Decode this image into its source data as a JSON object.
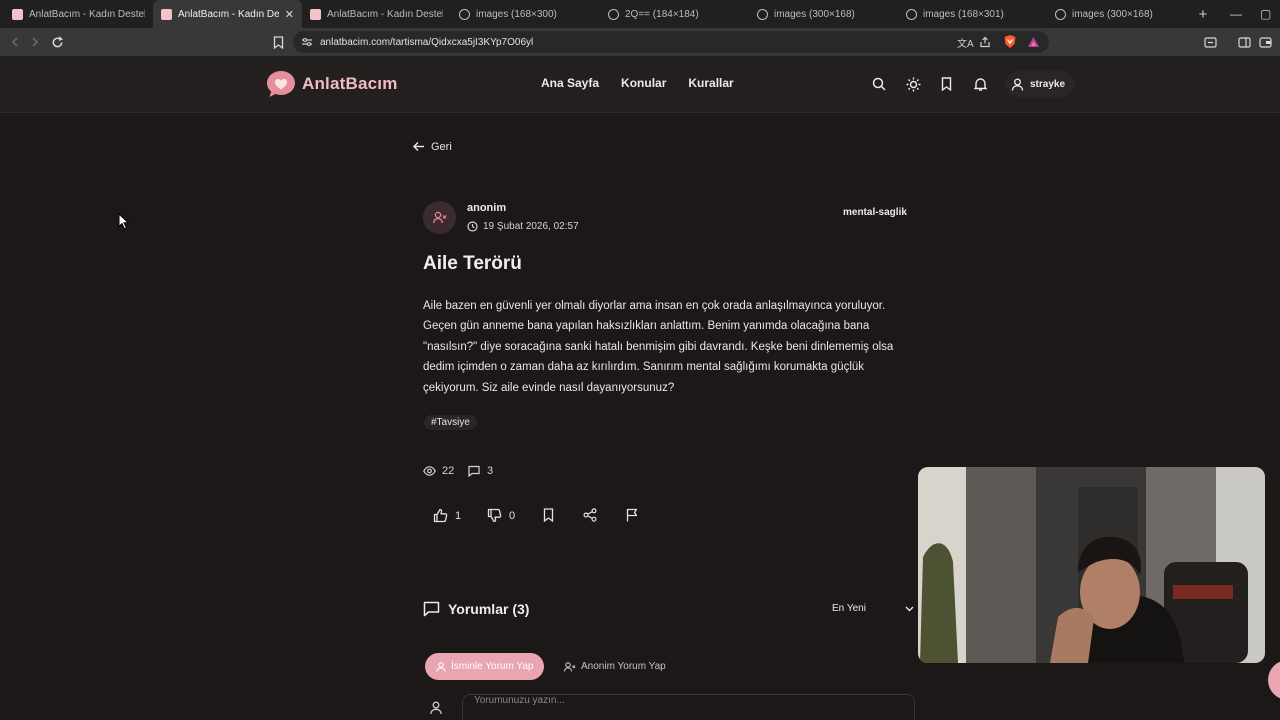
{
  "browser": {
    "tabs": [
      {
        "title": "AnlatBacım - Kadın Destek Platformu",
        "icon": "site-favicon",
        "active": false
      },
      {
        "title": "AnlatBacım - Kadın Destek Platformu",
        "icon": "site-favicon",
        "active": true
      },
      {
        "title": "AnlatBacım - Kadın Destek Platformu",
        "icon": "site-favicon",
        "active": false
      },
      {
        "title": "images (168×300)",
        "icon": "globe-icon",
        "active": false
      },
      {
        "title": "2Q== (184×184)",
        "icon": "globe-icon",
        "active": false
      },
      {
        "title": "images (300×168)",
        "icon": "globe-icon",
        "active": false
      },
      {
        "title": "images (168×301)",
        "icon": "globe-icon",
        "active": false
      },
      {
        "title": "images (300×168)",
        "icon": "globe-icon",
        "active": false
      }
    ],
    "url": "anlatbacim.com/tartisma/Qidxcxa5jI3KYp7O06yl"
  },
  "site": {
    "logo_text": "AnlatBacım",
    "nav": [
      "Ana Sayfa",
      "Konular",
      "Kurallar"
    ],
    "username": "strayke",
    "brand_color": "#e9a5b0"
  },
  "post": {
    "back_label": "Geri",
    "author": "anonim",
    "date": "19 Şubat 2026, 02:57",
    "category": "mental-saglik",
    "title": "Aile Terörü",
    "body": "Aile bazen en güvenli yer olmalı diyorlar ama insan en çok orada anlaşılmayınca yoruluyor. Geçen gün anneme bana yapılan haksızlıkları anlattım. Benim yanımda olacağına bana \"nasılsın?\" diye soracağına sanki hatalı benmişim gibi davrandı. Keşke beni dinlememiş olsa dedim içimden o zaman daha az kırılırdım. Sanırım mental sağlığımı korumakta güçlük çekiyorum.  Siz aile evinde nasıl dayanıyorsunuz?",
    "tag": "#Tavsiye",
    "views": "22",
    "comment_count": "3",
    "likes": "1",
    "dislikes": "0"
  },
  "comments": {
    "heading": "Yorumlar (3)",
    "sort_label": "En Yeni",
    "named_button": "İsminle Yorum Yap",
    "anon_button": "Anonim Yorum Yap",
    "input_placeholder": "Yorumunuzu yazın..."
  }
}
